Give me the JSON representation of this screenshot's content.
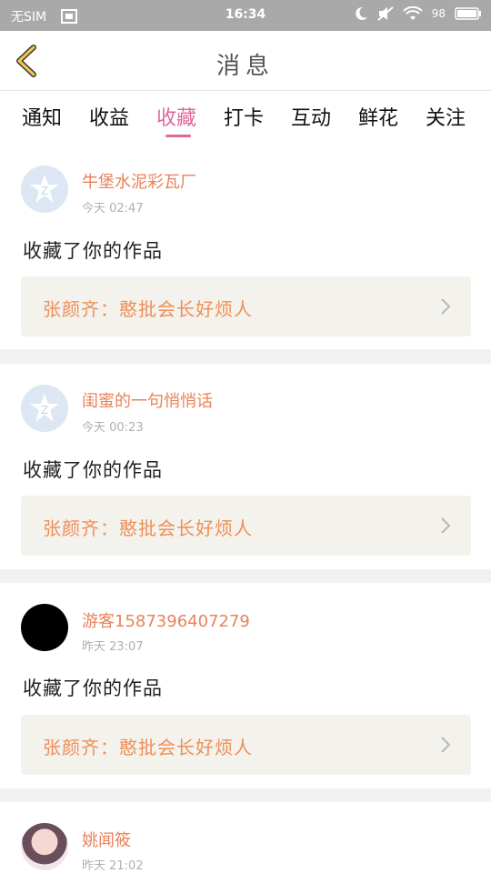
{
  "status_bar": {
    "carrier": "无SIM",
    "time": "16:34",
    "battery": "98"
  },
  "header": {
    "title": "消息",
    "back_icon": "chevron-left-icon"
  },
  "tabs": [
    {
      "label": "通知"
    },
    {
      "label": "收益"
    },
    {
      "label": "收藏"
    },
    {
      "label": "打卡"
    },
    {
      "label": "互动"
    },
    {
      "label": "鲜花"
    },
    {
      "label": "关注"
    }
  ],
  "active_tab": "收藏",
  "colors": {
    "accent": "#e0679a",
    "username": "#e8825a",
    "quote_text": "#ef8f58",
    "quote_bg": "#f3f2ec"
  },
  "messages": [
    {
      "username": "牛堡水泥彩瓦厂",
      "time": "今天 02:47",
      "action": "收藏了你的作品",
      "quote": "张颜齐：憨批会长好烦人",
      "avatar": "default-avatar-icon"
    },
    {
      "username": "闺蜜的一句悄悄话",
      "time": "今天 00:23",
      "action": "收藏了你的作品",
      "quote": "张颜齐：憨批会长好烦人",
      "avatar": "default-avatar-icon"
    },
    {
      "username": "游客1587396407279",
      "time": "昨天 23:07",
      "action": "收藏了你的作品",
      "quote": "张颜齐：憨批会长好烦人",
      "avatar": "black-avatar"
    },
    {
      "username": "姚闻筱",
      "time": "昨天 21:02",
      "avatar": "photo-avatar"
    }
  ]
}
